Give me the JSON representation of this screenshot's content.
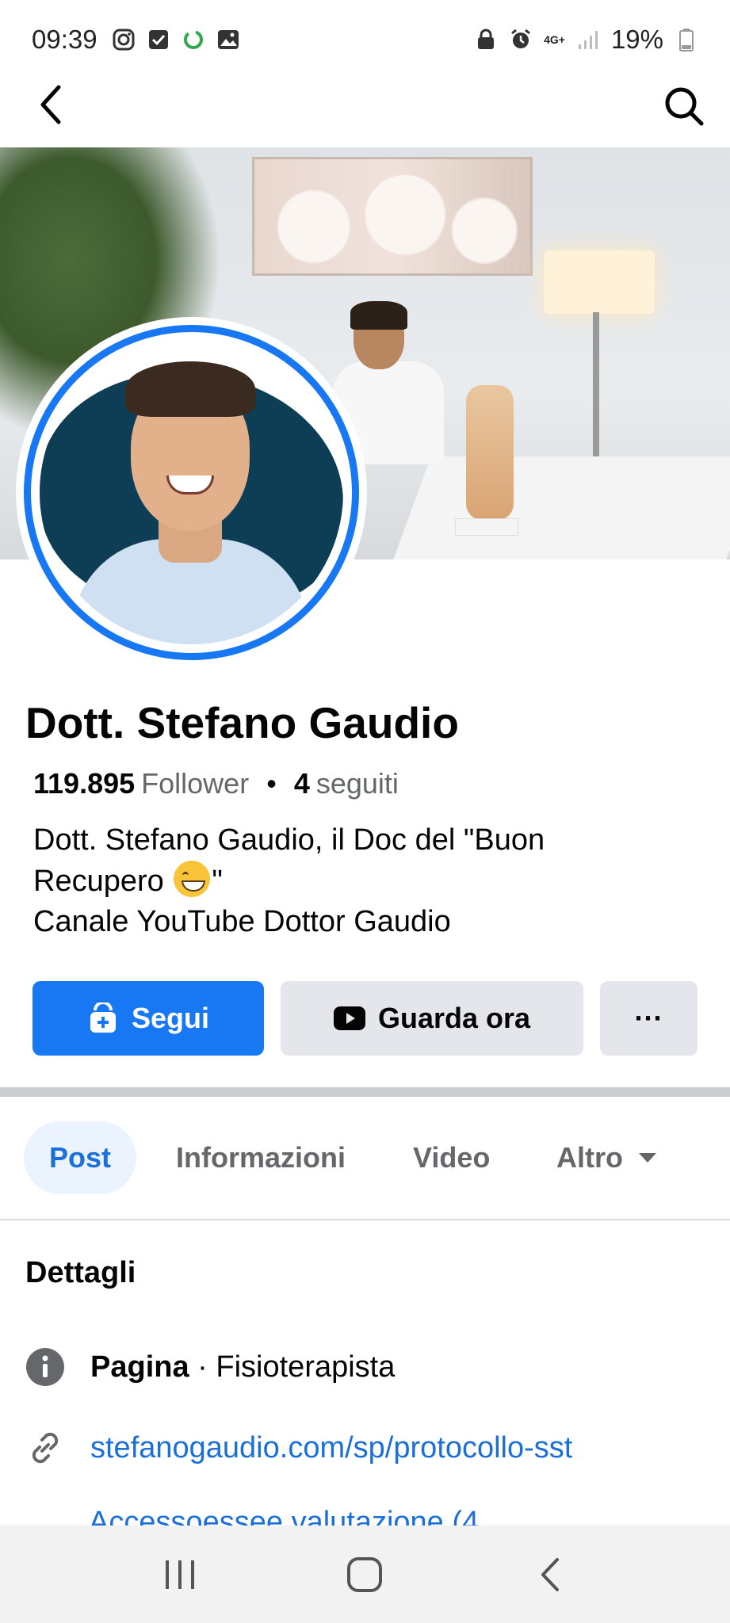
{
  "status_bar": {
    "time": "09:39",
    "network": "4G+",
    "battery": "19%"
  },
  "profile": {
    "name": "Dott. Stefano Gaudio",
    "followers_count": "119.895",
    "followers_label": "Follower",
    "separator": "•",
    "following_count": "4",
    "following_label": "seguiti",
    "bio_line1": "Dott. Stefano Gaudio, il Doc del \"Buon",
    "bio_line2_text": "Recupero",
    "bio_line2_end": "\"",
    "bio_line3": "Canale YouTube Dottor Gaudio"
  },
  "actions": {
    "follow_label": "Segui",
    "watch_label": "Guarda ora",
    "more_label": "···"
  },
  "tabs": [
    {
      "label": "Post",
      "active": true
    },
    {
      "label": "Informazioni",
      "active": false
    },
    {
      "label": "Video",
      "active": false
    },
    {
      "label": "Altro",
      "active": false
    }
  ],
  "details": {
    "title": "Dettagli",
    "category_label": "Pagina",
    "category_sep": "·",
    "category_value": "Fisioterapista",
    "website": "stefanogaudio.com/sp/protocollo-sst",
    "cut_off_text": "Accessoessee valutazione (4"
  },
  "colors": {
    "accent": "#1877f2",
    "link": "#1b6fd8",
    "secondary_button": "#e4e6eb"
  },
  "icons": {
    "back": "chevron-left",
    "search": "magnifier",
    "follow": "follow-bag",
    "watch": "youtube-play",
    "info": "info-circle",
    "link": "link-chain"
  }
}
